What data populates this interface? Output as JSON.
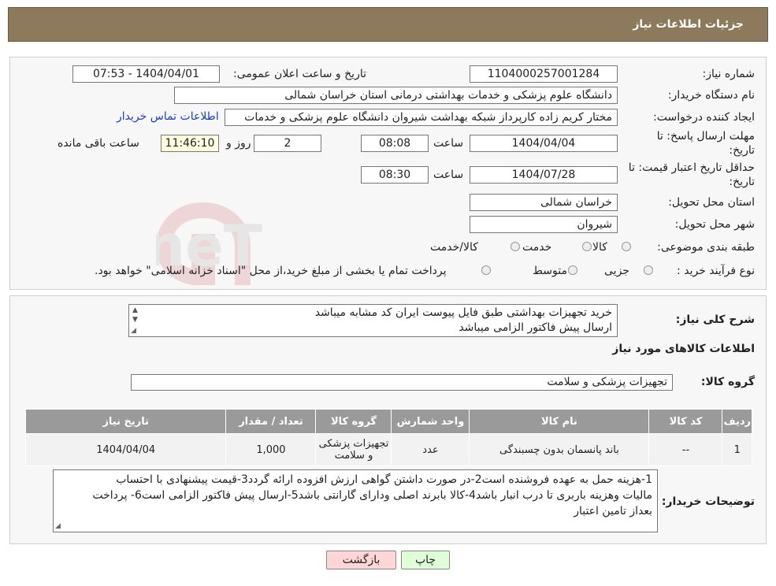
{
  "page": {
    "title": "جزئیات اطلاعات نیاز"
  },
  "fields": {
    "need_number_label": "شماره نیاز:",
    "need_number": "1104000257001284",
    "announce_label": "تاریخ و ساعت اعلان عمومی:",
    "announce_value": "1404/04/01 - 07:53",
    "buyer_org_label": "نام دستگاه خریدار:",
    "buyer_org": "دانشگاه علوم پزشکی و خدمات بهداشتی درمانی استان خراسان شمالی",
    "creator_label": "ایجاد کننده درخواست:",
    "creator": "مختار کریم زاده کارپرداز شبکه بهداشت شیروان دانشگاه علوم پزشکی و خدمات",
    "contact_link": "اطلاعات تماس خریدار",
    "deadline_label_1": "مهلت ارسال پاسخ: تا",
    "deadline_label_2": "تاریخ:",
    "deadline_date": "1404/04/04",
    "time_label": "ساعت",
    "deadline_time": "08:08",
    "days_value": "2",
    "days_label": "روز و",
    "remaining_time": "11:46:10",
    "remaining_label": "ساعت باقی مانده",
    "validity_label_1": "حداقل تاریخ اعتبار قیمت: تا",
    "validity_label_2": "تاریخ:",
    "validity_date": "1404/07/28",
    "validity_time": "08:30",
    "province_label": "استان محل تحویل:",
    "province": "خراسان شمالی",
    "city_label": "شهر محل تحویل:",
    "city": "شیروان",
    "category_label": "طبقه بندی موضوعی:",
    "category_options": [
      "کالا",
      "خدمت",
      "کالا/خدمت"
    ],
    "process_label": "نوع فرآیند خرید :",
    "process_options": [
      "جزیی",
      "متوسط"
    ],
    "process_note": "پرداخت تمام یا بخشی از مبلغ خرید،از محل \"اسناد خزانه اسلامی\" خواهد بود."
  },
  "description": {
    "label": "شرح کلی نیاز:",
    "lines": [
      "خرید تجهیزات بهداشتی طبق فایل پیوست ایران کد مشابه میباشد",
      "ارسال پیش فاکتور الزامی میباشد"
    ]
  },
  "goods": {
    "section_title": "اطلاعات کالاهای مورد نیاز",
    "group_label": "گروه کالا:",
    "group_value": "تجهیزات پزشکی و سلامت",
    "columns": [
      "ردیف",
      "کد کالا",
      "نام کالا",
      "واحد شمارش",
      "گروه کالا",
      "تعداد / مقدار",
      "تاریخ نیاز"
    ],
    "rows": [
      {
        "row": "1",
        "code": "--",
        "name": "باند پانسمان بدون چسبندگی",
        "unit": "عدد",
        "group": "تجهیزات پزشکی و سلامت",
        "qty": "1,000",
        "date": "1404/04/04"
      }
    ]
  },
  "buyer_notes": {
    "label": "توضیحات خریدار:",
    "lines": [
      "1-هزینه حمل به عهده فروشنده است2-در صورت داشتن گواهی ارزش افزوده ارائه گردد3-قیمت پیشنهادی با احتساب",
      "مالیات وهزینه باربری تا درب انبار  باشد4-کالا بابرند اصلی ودارای گارانتی باشد5-ارسال پیش فاکتور الزامی است6- پرداخت",
      "بعداز تامین اعتبار"
    ]
  },
  "buttons": {
    "back": "بازگشت",
    "print": "چاپ"
  },
  "watermark": "AriaTender.neT"
}
